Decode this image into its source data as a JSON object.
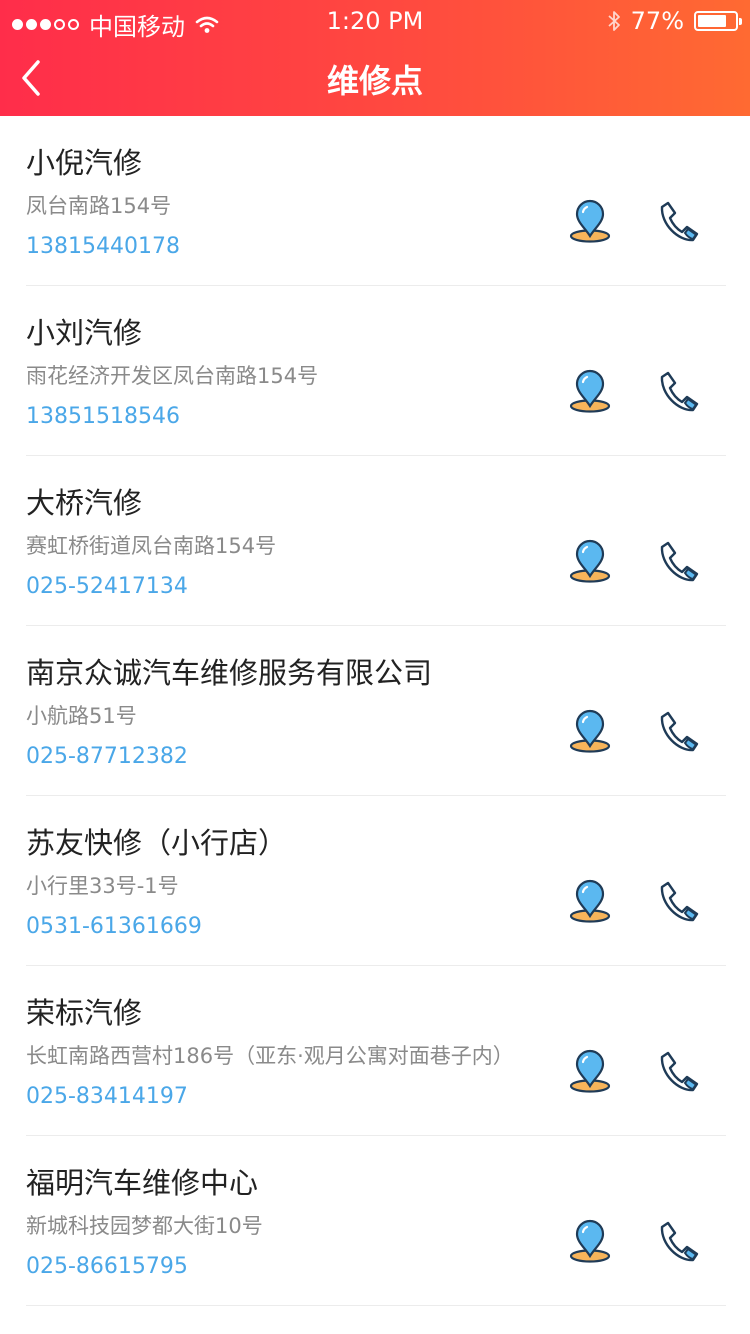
{
  "status_bar": {
    "carrier": "中国移动",
    "time": "1:20 PM",
    "battery": "77%"
  },
  "nav": {
    "title": "维修点"
  },
  "shops": [
    {
      "name": "小倪汽修",
      "address": "凤台南路154号",
      "phone": "13815440178"
    },
    {
      "name": "小刘汽修",
      "address": "雨花经济开发区凤台南路154号",
      "phone": "13851518546"
    },
    {
      "name": "大桥汽修",
      "address": "赛虹桥街道凤台南路154号",
      "phone": "025-52417134"
    },
    {
      "name": "南京众诚汽车维修服务有限公司",
      "address": "小航路51号",
      "phone": "025-87712382"
    },
    {
      "name": "苏友快修（小行店）",
      "address": "小行里33号-1号",
      "phone": "0531-61361669"
    },
    {
      "name": "荣标汽修",
      "address": "长虹南路西营村186号（亚东·观月公寓对面巷子内）",
      "phone": "025-83414197"
    },
    {
      "name": "福明汽车维修中心",
      "address": "新城科技园梦都大街10号",
      "phone": "025-86615795"
    }
  ],
  "colors": {
    "header_start": "#ff2d4a",
    "header_end": "#ff6a32",
    "phone_text": "#4aa7e8",
    "icon_blue": "#5bb8f0",
    "icon_orange": "#f7b45a"
  },
  "icons": {
    "back": "chevron-left-icon",
    "location": "map-pin-icon",
    "call": "phone-icon"
  }
}
